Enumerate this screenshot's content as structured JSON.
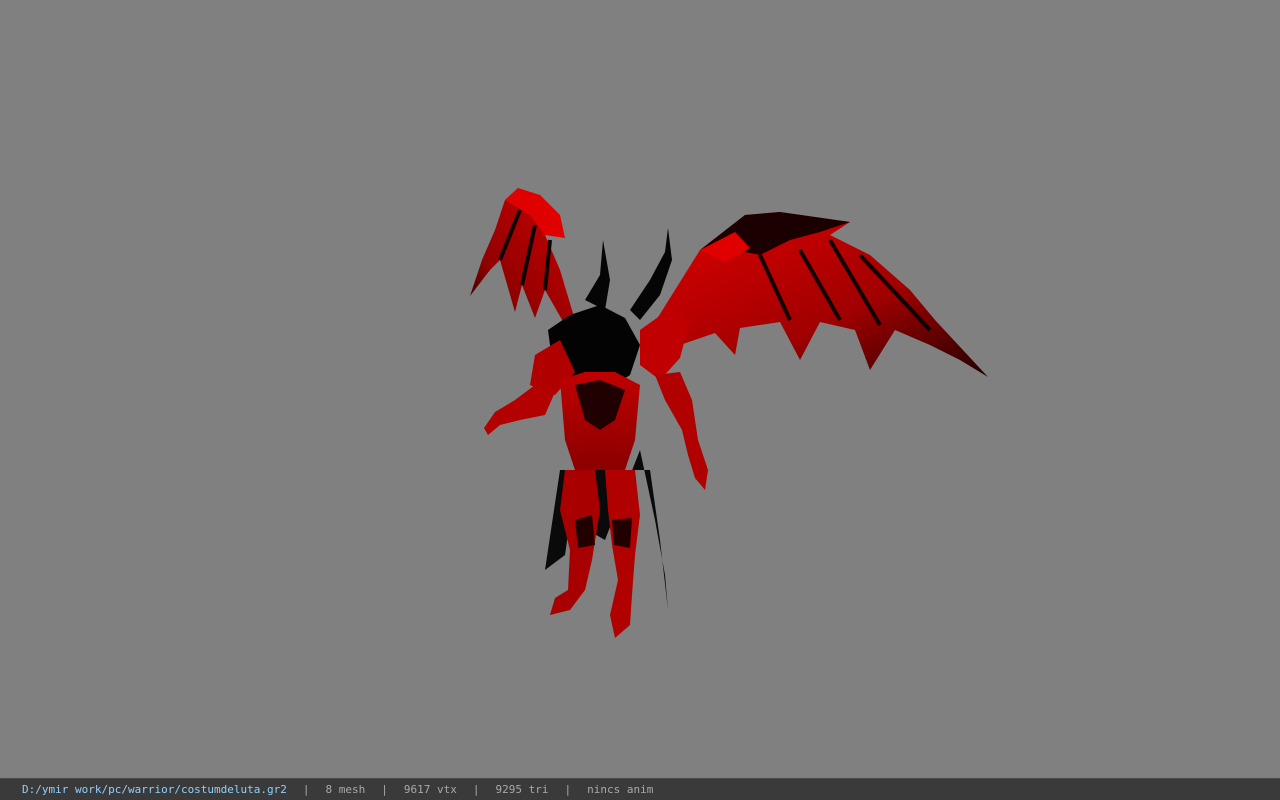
{
  "viewer": {
    "background_color": "#808080",
    "model": {
      "subject": "demon-winged-warrior-costume",
      "primary_color": "#cc0000",
      "secondary_color": "#000000"
    }
  },
  "status_bar": {
    "file_path": "D:/ymir work/pc/warrior/costumdeluta.gr2",
    "separator": "|",
    "mesh_count": "8 mesh",
    "vertex_count": "9617 vtx",
    "triangle_count": "9295 tri",
    "animation": "nincs anim",
    "path_color": "#8fd0ff",
    "text_color": "#a9a9a9"
  }
}
